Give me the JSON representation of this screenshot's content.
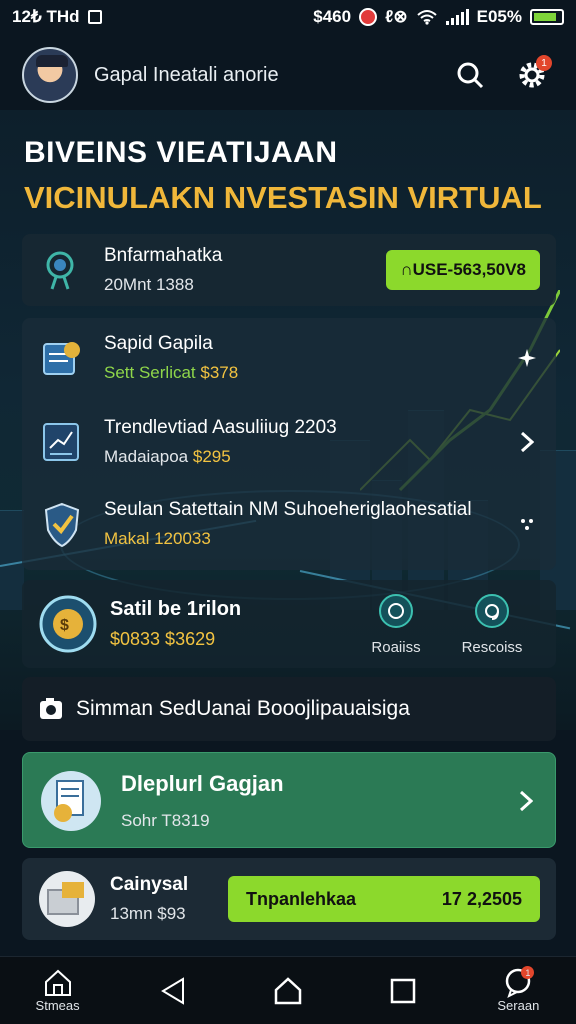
{
  "status_bar": {
    "time": "12₺ THd",
    "price": "$460",
    "battery_pct": "E05%"
  },
  "header": {
    "user_name": "Gapal Ineatali anorie",
    "search_icon": "search-icon",
    "settings_icon": "gear-icon",
    "badge": "1"
  },
  "titles": {
    "line1": "BIVEINS VIEATIJAAN",
    "line2": "VICINULAKN NVESTASIN VIRTUAL"
  },
  "account": {
    "name": "Bnfarmahatka",
    "sub": "20Mnt 1388",
    "balance": "∩USE-563,50V8"
  },
  "investments": [
    {
      "title": "Sapid Gapila",
      "sub_prefix": "Sett Serlicat",
      "sub_value": "$378"
    },
    {
      "title": "Trendlevtiad Aasuliiug 2203",
      "sub_prefix": "Madaiapoa",
      "sub_value": "$295"
    },
    {
      "title": "Seulan Satettain NM Suhoeheriglaohesatial",
      "sub_prefix": "Makal",
      "sub_value": "120033"
    }
  ],
  "summary": {
    "title": "Satil be 1rilon",
    "values": "$0833 $3629",
    "action1_label": "Roaiiss",
    "action2_label": "Rescoiss"
  },
  "notice": "Simman SedUanai Booojlipauaisiga",
  "deploy_card": {
    "title": "Dleplurl Gagjan",
    "sub": "Sohr T8319"
  },
  "bottom_card": {
    "title": "Cainysal",
    "sub": "13mn $93",
    "button_label": "Tnpanlehkaa",
    "button_value": "17 2,2505"
  },
  "nav": {
    "home_label": "Stmeas",
    "chat_label": "Seraan",
    "chat_badge": "1"
  },
  "colors": {
    "accent_green": "#8cd92c",
    "gold": "#f0b73a",
    "card_green": "#2b7a55"
  }
}
